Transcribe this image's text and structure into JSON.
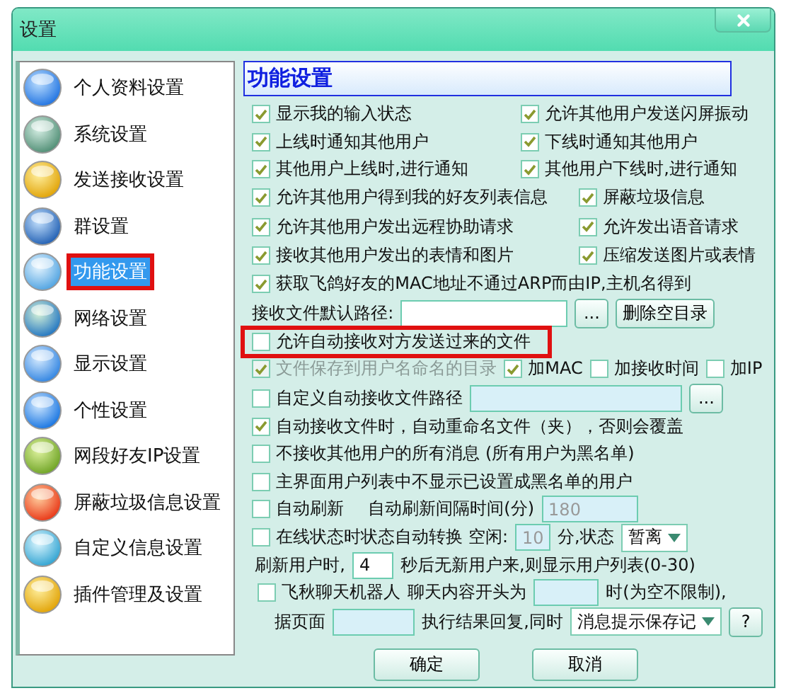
{
  "window": {
    "title": "设置"
  },
  "sidebar": {
    "items": [
      {
        "label": "个人资料设置",
        "selected": false,
        "highlighted": false
      },
      {
        "label": "系统设置",
        "selected": false,
        "highlighted": false
      },
      {
        "label": "发送接收设置",
        "selected": false,
        "highlighted": false
      },
      {
        "label": "群设置",
        "selected": false,
        "highlighted": false
      },
      {
        "label": "功能设置",
        "selected": true,
        "highlighted": true
      },
      {
        "label": "网络设置",
        "selected": false,
        "highlighted": false
      },
      {
        "label": "显示设置",
        "selected": false,
        "highlighted": false
      },
      {
        "label": "个性设置",
        "selected": false,
        "highlighted": false
      },
      {
        "label": "网段好友IP设置",
        "selected": false,
        "highlighted": false
      },
      {
        "label": "屏蔽垃圾信息设置",
        "selected": false,
        "highlighted": false
      },
      {
        "label": "自定义信息设置",
        "selected": false,
        "highlighted": false
      },
      {
        "label": "插件管理及设置",
        "selected": false,
        "highlighted": false
      }
    ]
  },
  "panel": {
    "heading": "功能设置",
    "rows": [
      {
        "kind": "pair",
        "highlighted": false,
        "items": [
          {
            "kind": "checkbox",
            "label": "显示我的输入状态",
            "checked": true,
            "disabled": false
          },
          {
            "kind": "checkbox",
            "label": "允许其他用户发送闪屏振动",
            "checked": true,
            "disabled": false
          }
        ]
      },
      {
        "kind": "pair",
        "highlighted": false,
        "items": [
          {
            "kind": "checkbox",
            "label": "上线时通知其他用户",
            "checked": true,
            "disabled": false
          },
          {
            "kind": "checkbox",
            "label": "下线时通知其他用户",
            "checked": true,
            "disabled": false
          }
        ]
      },
      {
        "kind": "pair",
        "highlighted": false,
        "items": [
          {
            "kind": "checkbox",
            "label": "其他用户上线时,进行通知",
            "checked": true,
            "disabled": false
          },
          {
            "kind": "checkbox",
            "label": "其他用户下线时,进行通知",
            "checked": true,
            "disabled": false
          }
        ]
      },
      {
        "kind": "pair-wide",
        "highlighted": false,
        "items": [
          {
            "kind": "checkbox",
            "label": "允许其他用户得到我的好友列表信息",
            "checked": true,
            "disabled": false
          },
          {
            "kind": "checkbox",
            "label": "屏蔽垃圾信息",
            "checked": true,
            "disabled": false
          }
        ]
      },
      {
        "kind": "pair-wide",
        "highlighted": false,
        "items": [
          {
            "kind": "checkbox",
            "label": "允许其他用户发出远程协助请求",
            "checked": true,
            "disabled": false
          },
          {
            "kind": "checkbox",
            "label": "允许发出语音请求",
            "checked": true,
            "disabled": false
          }
        ]
      },
      {
        "kind": "pair-wide",
        "highlighted": false,
        "items": [
          {
            "kind": "checkbox",
            "label": "接收其他用户发出的表情和图片",
            "checked": true,
            "disabled": false
          },
          {
            "kind": "checkbox",
            "label": "压缩发送图片或表情",
            "checked": true,
            "disabled": false
          }
        ]
      },
      {
        "kind": "line",
        "highlighted": false,
        "items": [
          {
            "kind": "checkbox",
            "label": "获取飞鸽好友的MAC地址不通过ARP而由IP,主机名得到",
            "checked": true,
            "disabled": false
          }
        ]
      },
      {
        "kind": "line",
        "highlighted": false,
        "items": [
          {
            "kind": "label",
            "text": "接收文件默认路径:"
          },
          {
            "kind": "input",
            "disabled": false
          },
          {
            "kind": "button",
            "label": "..."
          },
          {
            "kind": "button",
            "label": "删除空目录"
          }
        ]
      },
      {
        "kind": "line",
        "highlighted": true,
        "items": [
          {
            "kind": "checkbox",
            "label": "允许自动接收对方发送过来的文件",
            "checked": false,
            "disabled": false
          }
        ]
      },
      {
        "kind": "line",
        "highlighted": false,
        "items": [
          {
            "kind": "checkbox",
            "label": "文件保存到用户名命名的目录",
            "checked": true,
            "disabled": true
          },
          {
            "kind": "checkbox",
            "label": "加MAC",
            "checked": true,
            "disabled": false
          },
          {
            "kind": "checkbox",
            "label": "加接收时间",
            "checked": false,
            "disabled": false
          },
          {
            "kind": "checkbox",
            "label": "加IP",
            "checked": false,
            "disabled": false
          }
        ]
      },
      {
        "kind": "line",
        "highlighted": false,
        "items": [
          {
            "kind": "checkbox",
            "label": "自定义自动接收文件路径",
            "checked": false,
            "disabled": false
          },
          {
            "kind": "input",
            "disabled": true
          },
          {
            "kind": "button",
            "label": "..."
          }
        ]
      },
      {
        "kind": "line",
        "highlighted": false,
        "items": [
          {
            "kind": "checkbox",
            "label": "自动接收文件时，自动重命名文件（夹），否则会覆盖",
            "checked": true,
            "disabled": false
          }
        ]
      },
      {
        "kind": "line",
        "highlighted": false,
        "items": [
          {
            "kind": "checkbox",
            "label": "不接收其他用户的所有消息 (所有用户为黑名单)",
            "checked": false,
            "disabled": false
          }
        ]
      },
      {
        "kind": "line",
        "highlighted": false,
        "items": [
          {
            "kind": "checkbox",
            "label": "主界面用户列表中不显示已设置成黑名单的用户",
            "checked": false,
            "disabled": false
          }
        ]
      },
      {
        "kind": "line",
        "highlighted": false,
        "items": [
          {
            "kind": "checkbox",
            "label": "自动刷新",
            "checked": false,
            "disabled": false
          },
          {
            "kind": "label",
            "text": "自动刷新间隔时间(分)"
          },
          {
            "kind": "input",
            "value": "180",
            "disabled": true
          }
        ]
      },
      {
        "kind": "line",
        "highlighted": false,
        "items": [
          {
            "kind": "checkbox",
            "label": "在线状态时状态自动转换 空闲:",
            "checked": false,
            "disabled": false
          },
          {
            "kind": "input",
            "value": "10",
            "disabled": true
          },
          {
            "kind": "label",
            "text": "分,状态"
          },
          {
            "kind": "select",
            "value": "暂离"
          }
        ]
      },
      {
        "kind": "line",
        "highlighted": false,
        "items": [
          {
            "kind": "label",
            "text": "刷新用户时,"
          },
          {
            "kind": "input",
            "value": "4",
            "disabled": false
          },
          {
            "kind": "label",
            "text": "秒后无新用户来,则显示用户列表(0-30)"
          }
        ]
      },
      {
        "kind": "line",
        "highlighted": false,
        "items": [
          {
            "kind": "checkbox",
            "label": "飞秋聊天机器人",
            "checked": false,
            "disabled": false
          },
          {
            "kind": "label",
            "text": "聊天内容开头为"
          },
          {
            "kind": "input",
            "disabled": true
          },
          {
            "kind": "label",
            "text": "时(为空不限制),"
          }
        ]
      },
      {
        "kind": "line",
        "highlighted": false,
        "items": [
          {
            "kind": "label",
            "text": "据页面"
          },
          {
            "kind": "input",
            "disabled": true
          },
          {
            "kind": "label",
            "text": "执行结果回复,同时"
          },
          {
            "kind": "select",
            "value": "消息提示保存记"
          },
          {
            "kind": "button",
            "label": "?"
          }
        ]
      }
    ]
  },
  "buttons": [
    "确定",
    "取消"
  ]
}
